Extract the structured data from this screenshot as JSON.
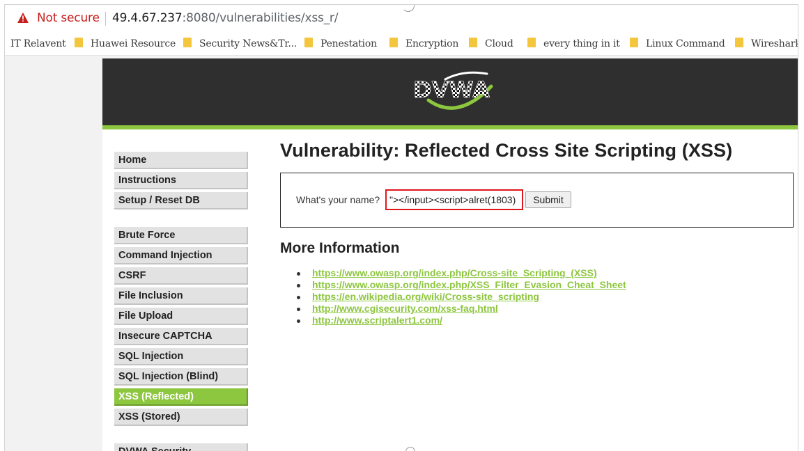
{
  "browser": {
    "security_label": "Not secure",
    "url_host": "49.4.67.237",
    "url_path": ":8080/vulnerabilities/xss_r/",
    "bookmarks": [
      {
        "label": "IT Relavent",
        "folder": false
      },
      {
        "label": "Huawei Resource",
        "folder": true
      },
      {
        "label": "Security News&Tr...",
        "folder": true
      },
      {
        "label": "Penestation",
        "folder": true
      },
      {
        "label": "Encryption",
        "folder": true
      },
      {
        "label": "Cloud",
        "folder": true
      },
      {
        "label": "every thing in it",
        "folder": true
      },
      {
        "label": "Linux Command",
        "folder": true
      },
      {
        "label": "Wireshark",
        "folder": true
      }
    ]
  },
  "logo": {
    "text": "DVWA"
  },
  "menu": {
    "group1": [
      "Home",
      "Instructions",
      "Setup / Reset DB"
    ],
    "group2": [
      "Brute Force",
      "Command Injection",
      "CSRF",
      "File Inclusion",
      "File Upload",
      "Insecure CAPTCHA",
      "SQL Injection",
      "SQL Injection (Blind)",
      "XSS (Reflected)",
      "XSS (Stored)"
    ],
    "active": "XSS (Reflected)",
    "group3": [
      "DVWA Security"
    ]
  },
  "main": {
    "title": "Vulnerability: Reflected Cross Site Scripting (XSS)",
    "form": {
      "label": "What's your name?",
      "input_value": "\"></input><script>alret(1803)",
      "submit_label": "Submit"
    },
    "more_info_title": "More Information",
    "links": [
      "https://www.owasp.org/index.php/Cross-site_Scripting_(XSS)",
      "https://www.owasp.org/index.php/XSS_Filter_Evasion_Cheat_Sheet",
      "https://en.wikipedia.org/wiki/Cross-site_scripting",
      "http://www.cgisecurity.com/xss-faq.html",
      "http://www.scriptalert1.com/"
    ]
  },
  "colors": {
    "accent": "#8dc63f",
    "header_bg": "#2f2f2f",
    "warning": "#c5221f",
    "highlight_border": "#e0161b"
  }
}
